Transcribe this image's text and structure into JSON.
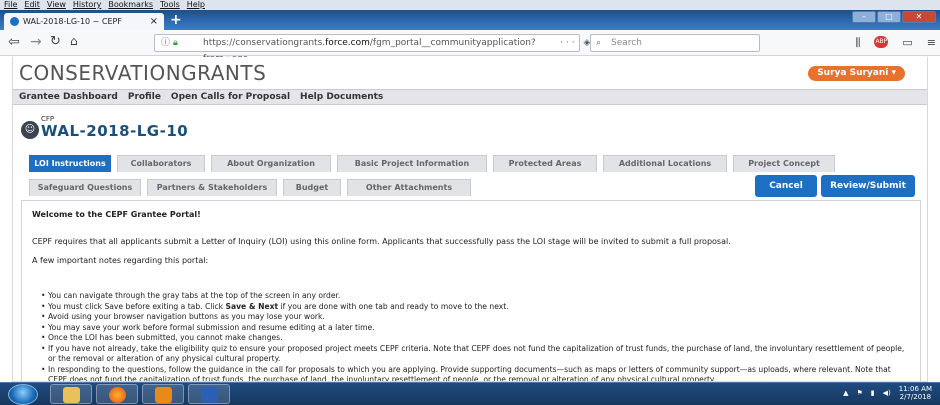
{
  "menubar": [
    "File",
    "Edit",
    "View",
    "History",
    "Bookmarks",
    "Tools",
    "Help"
  ],
  "browser": {
    "tab_title": "WAL-2018-LG-10 ~ CEPF",
    "url_prefix": "https://conservationgrants.",
    "url_domain": "force.com",
    "url_path": "/fgm_portal__communityapplication?from=egc",
    "url_tools": "··· ◈ ☆",
    "search_placeholder": "Search"
  },
  "header": {
    "logo": "CONSERVATIONGRANTS",
    "user": "Surya Suryani ▾"
  },
  "portal_nav": [
    "Grantee Dashboard",
    "Profile",
    "Open Calls for Proposal",
    "Help Documents"
  ],
  "record": {
    "type": "CFP",
    "title": "WAL-2018-LG-10"
  },
  "tabs_row1": [
    {
      "label": "LOI Instructions",
      "active": true
    },
    {
      "label": "Collaborators",
      "active": false
    },
    {
      "label": "About Organization",
      "active": false
    },
    {
      "label": "Basic Project Information",
      "active": false
    },
    {
      "label": "Protected Areas",
      "active": false
    },
    {
      "label": "Additional Locations",
      "active": false
    },
    {
      "label": "Project Concept",
      "active": false
    }
  ],
  "tabs_row2": [
    {
      "label": "Safeguard Questions",
      "active": false
    },
    {
      "label": "Partners & Stakeholders",
      "active": false
    },
    {
      "label": "Budget",
      "active": false
    },
    {
      "label": "Other Attachments",
      "active": false
    }
  ],
  "actions": {
    "cancel": "Cancel",
    "review": "Review/Submit"
  },
  "content": {
    "heading": "Welcome to the CEPF Grantee Portal!",
    "para1": "CEPF requires that all applicants submit a Letter of Inquiry (LOI) using this online form. Applicants that successfully pass the LOI stage will be invited to submit a full proposal.",
    "para2": "A few important notes regarding this portal:",
    "notes": [
      "You can navigate through the gray tabs at the top of the screen in any order.",
      "You must click Save before exiting a tab. Click Save & Next if you are done with one tab and ready to move to the next.",
      "Avoid using your browser navigation buttons as you may lose your work.",
      "You may save your work before formal submission and resume editing at a later time.",
      "Once the LOI has been submitted, you cannot make changes.",
      "If you have not already, take the eligibility quiz to ensure your proposed project meets CEPF criteria. Note that CEPF does not fund the capitalization of trust funds, the purchase of land, the involuntary resettlement of people, or the removal or alteration of any physical cultural property.",
      "In responding to the questions, follow the guidance in the call for proposals to which you are applying. Provide supporting documents—such as maps or letters of community support—as uploads, where relevant. Note that CEPF does not fund the capitalization of trust funds, the purchase of land, the involuntary resettlement of people, or the removal or alteration of any physical cultural property."
    ]
  },
  "taskbar": {
    "time": "11:06 AM",
    "date": "2/7/2018"
  }
}
